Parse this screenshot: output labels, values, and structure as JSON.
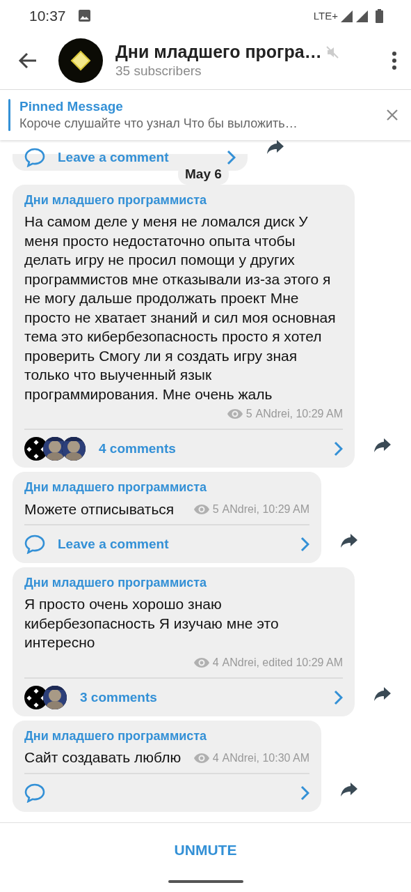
{
  "status_bar": {
    "time": "10:37",
    "network": "LTE+"
  },
  "header": {
    "title": "Дни младшего програ…",
    "subtitle": "35 subscribers",
    "muted": true
  },
  "pinned": {
    "title": "Pinned Message",
    "text": "Короче слушайте что узнал  Что бы выложить…"
  },
  "feed": [
    {
      "kind": "stub",
      "footer": {
        "kind": "leave",
        "label": "Leave a comment"
      }
    },
    {
      "kind": "date",
      "label": "May 6"
    },
    {
      "kind": "post",
      "author": "Дни младшего программиста",
      "text": "На самом деле у меня не ломался диск У меня просто недостаточно опыта чтобы делать игру не просил помощи у других программистов мне отказывали из-за этого я не могу дальше продолжать проект Мне просто не хватает знаний и сил моя основная тема это кибербезопасность просто я хотел проверить Смогу ли я создать игру зная только что выученный язык программирования. Мне очень жаль",
      "views": "5",
      "signature": "ANdrei, 10:29 AM",
      "footer": {
        "kind": "comments",
        "label": "4 comments",
        "avatars": [
          {
            "kind": "dots"
          },
          {
            "kind": "picture"
          },
          {
            "kind": "picture"
          }
        ]
      }
    },
    {
      "kind": "post",
      "author": "Дни младшего программиста",
      "text": "Можете отписываться",
      "views": "5",
      "signature": "ANdrei, 10:29 AM",
      "footer": {
        "kind": "leave",
        "label": "Leave a comment"
      }
    },
    {
      "kind": "post",
      "author": "Дни младшего программиста",
      "text": "Я просто очень хорошо знаю кибербезопасность Я изучаю мне это интересно",
      "views": "4",
      "signature": "ANdrei, edited 10:29 AM",
      "footer": {
        "kind": "comments",
        "label": "3 comments",
        "avatars": [
          {
            "kind": "dots"
          },
          {
            "kind": "picture"
          }
        ]
      }
    },
    {
      "kind": "post",
      "author": "Дни младшего программиста",
      "text": "Сайт создавать люблю",
      "views": "4",
      "signature": "ANdrei, 10:30 AM",
      "footer": {
        "kind": "leave"
      }
    }
  ],
  "bottom_bar": {
    "button": "UNMUTE"
  }
}
